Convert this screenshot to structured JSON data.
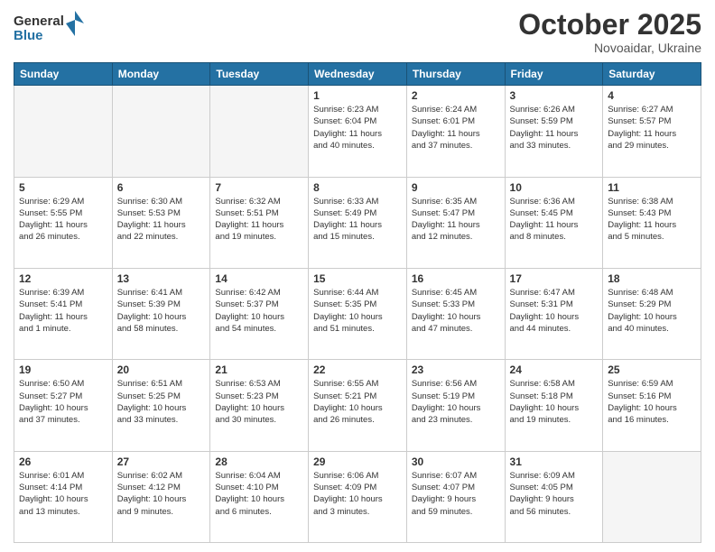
{
  "header": {
    "logo_line1": "General",
    "logo_line2": "Blue",
    "month": "October 2025",
    "location": "Novoaidar, Ukraine"
  },
  "weekdays": [
    "Sunday",
    "Monday",
    "Tuesday",
    "Wednesday",
    "Thursday",
    "Friday",
    "Saturday"
  ],
  "weeks": [
    [
      {
        "day": "",
        "empty": true
      },
      {
        "day": "",
        "empty": true
      },
      {
        "day": "",
        "empty": true
      },
      {
        "day": "1",
        "info": "Sunrise: 6:23 AM\nSunset: 6:04 PM\nDaylight: 11 hours\nand 40 minutes."
      },
      {
        "day": "2",
        "info": "Sunrise: 6:24 AM\nSunset: 6:01 PM\nDaylight: 11 hours\nand 37 minutes."
      },
      {
        "day": "3",
        "info": "Sunrise: 6:26 AM\nSunset: 5:59 PM\nDaylight: 11 hours\nand 33 minutes."
      },
      {
        "day": "4",
        "info": "Sunrise: 6:27 AM\nSunset: 5:57 PM\nDaylight: 11 hours\nand 29 minutes."
      }
    ],
    [
      {
        "day": "5",
        "info": "Sunrise: 6:29 AM\nSunset: 5:55 PM\nDaylight: 11 hours\nand 26 minutes."
      },
      {
        "day": "6",
        "info": "Sunrise: 6:30 AM\nSunset: 5:53 PM\nDaylight: 11 hours\nand 22 minutes."
      },
      {
        "day": "7",
        "info": "Sunrise: 6:32 AM\nSunset: 5:51 PM\nDaylight: 11 hours\nand 19 minutes."
      },
      {
        "day": "8",
        "info": "Sunrise: 6:33 AM\nSunset: 5:49 PM\nDaylight: 11 hours\nand 15 minutes."
      },
      {
        "day": "9",
        "info": "Sunrise: 6:35 AM\nSunset: 5:47 PM\nDaylight: 11 hours\nand 12 minutes."
      },
      {
        "day": "10",
        "info": "Sunrise: 6:36 AM\nSunset: 5:45 PM\nDaylight: 11 hours\nand 8 minutes."
      },
      {
        "day": "11",
        "info": "Sunrise: 6:38 AM\nSunset: 5:43 PM\nDaylight: 11 hours\nand 5 minutes."
      }
    ],
    [
      {
        "day": "12",
        "info": "Sunrise: 6:39 AM\nSunset: 5:41 PM\nDaylight: 11 hours\nand 1 minute."
      },
      {
        "day": "13",
        "info": "Sunrise: 6:41 AM\nSunset: 5:39 PM\nDaylight: 10 hours\nand 58 minutes."
      },
      {
        "day": "14",
        "info": "Sunrise: 6:42 AM\nSunset: 5:37 PM\nDaylight: 10 hours\nand 54 minutes."
      },
      {
        "day": "15",
        "info": "Sunrise: 6:44 AM\nSunset: 5:35 PM\nDaylight: 10 hours\nand 51 minutes."
      },
      {
        "day": "16",
        "info": "Sunrise: 6:45 AM\nSunset: 5:33 PM\nDaylight: 10 hours\nand 47 minutes."
      },
      {
        "day": "17",
        "info": "Sunrise: 6:47 AM\nSunset: 5:31 PM\nDaylight: 10 hours\nand 44 minutes."
      },
      {
        "day": "18",
        "info": "Sunrise: 6:48 AM\nSunset: 5:29 PM\nDaylight: 10 hours\nand 40 minutes."
      }
    ],
    [
      {
        "day": "19",
        "info": "Sunrise: 6:50 AM\nSunset: 5:27 PM\nDaylight: 10 hours\nand 37 minutes."
      },
      {
        "day": "20",
        "info": "Sunrise: 6:51 AM\nSunset: 5:25 PM\nDaylight: 10 hours\nand 33 minutes."
      },
      {
        "day": "21",
        "info": "Sunrise: 6:53 AM\nSunset: 5:23 PM\nDaylight: 10 hours\nand 30 minutes."
      },
      {
        "day": "22",
        "info": "Sunrise: 6:55 AM\nSunset: 5:21 PM\nDaylight: 10 hours\nand 26 minutes."
      },
      {
        "day": "23",
        "info": "Sunrise: 6:56 AM\nSunset: 5:19 PM\nDaylight: 10 hours\nand 23 minutes."
      },
      {
        "day": "24",
        "info": "Sunrise: 6:58 AM\nSunset: 5:18 PM\nDaylight: 10 hours\nand 19 minutes."
      },
      {
        "day": "25",
        "info": "Sunrise: 6:59 AM\nSunset: 5:16 PM\nDaylight: 10 hours\nand 16 minutes."
      }
    ],
    [
      {
        "day": "26",
        "info": "Sunrise: 6:01 AM\nSunset: 4:14 PM\nDaylight: 10 hours\nand 13 minutes."
      },
      {
        "day": "27",
        "info": "Sunrise: 6:02 AM\nSunset: 4:12 PM\nDaylight: 10 hours\nand 9 minutes."
      },
      {
        "day": "28",
        "info": "Sunrise: 6:04 AM\nSunset: 4:10 PM\nDaylight: 10 hours\nand 6 minutes."
      },
      {
        "day": "29",
        "info": "Sunrise: 6:06 AM\nSunset: 4:09 PM\nDaylight: 10 hours\nand 3 minutes."
      },
      {
        "day": "30",
        "info": "Sunrise: 6:07 AM\nSunset: 4:07 PM\nDaylight: 9 hours\nand 59 minutes."
      },
      {
        "day": "31",
        "info": "Sunrise: 6:09 AM\nSunset: 4:05 PM\nDaylight: 9 hours\nand 56 minutes."
      },
      {
        "day": "",
        "empty": true
      }
    ]
  ]
}
